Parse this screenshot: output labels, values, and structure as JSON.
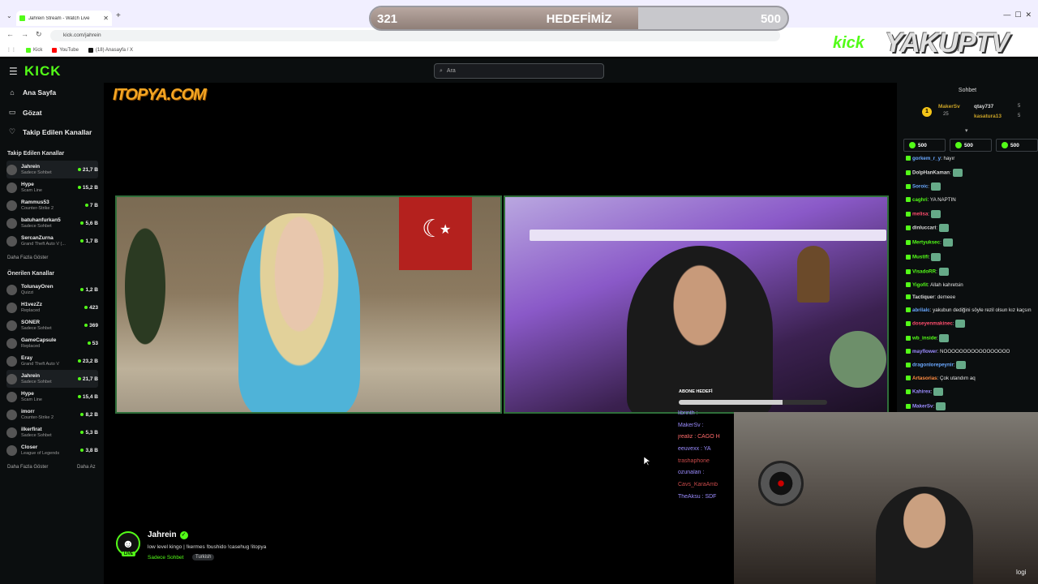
{
  "browser": {
    "tab_title": "Jahrein Stream - Watch Live",
    "url": "kick.com/jahrein",
    "bookmarks": [
      {
        "label": "Kick",
        "color": "#53fc18"
      },
      {
        "label": "YouTube",
        "color": "#ff0000"
      },
      {
        "label": "(18) Anasayfa / X",
        "color": "#111111"
      }
    ]
  },
  "goal": {
    "current": "321",
    "title": "HEDEFİMİZ",
    "target": "500",
    "progress": 0.642
  },
  "overlay_brand": {
    "kick": "kick",
    "name": "YAKUPTV"
  },
  "header": {
    "search_placeholder": "Ara"
  },
  "sidebar": {
    "nav": [
      {
        "label": "Ana Sayfa",
        "icon": "home-icon"
      },
      {
        "label": "Gözat",
        "icon": "browse-icon"
      },
      {
        "label": "Takip Edilen Kanallar",
        "icon": "heart-icon"
      }
    ],
    "followed_header": "Takip Edilen Kanallar",
    "followed": [
      {
        "name": "Jahrein",
        "category": "Sadece Sohbet",
        "viewers": "21,7 B",
        "active": true
      },
      {
        "name": "Hype",
        "category": "Scam Line",
        "viewers": "15,2 B"
      },
      {
        "name": "Rammus53",
        "category": "Counter-Strike 2",
        "viewers": "7 B"
      },
      {
        "name": "batuhanfurkan5",
        "category": "Sadece Sohbet",
        "viewers": "5,6 B"
      },
      {
        "name": "SercanZurna",
        "category": "Grand Theft Auto V (...",
        "viewers": "1,7 B"
      }
    ],
    "followed_more": "Daha Fazla Göster",
    "recommended_header": "Önerilen Kanallar",
    "recommended": [
      {
        "name": "TolunayOren",
        "category": "Quizzi",
        "viewers": "1,2 B"
      },
      {
        "name": "H1vezZz",
        "category": "Replaced",
        "viewers": "423"
      },
      {
        "name": "SONER",
        "category": "Sadece Sohbet",
        "viewers": "369"
      },
      {
        "name": "GameCapsule",
        "category": "Replaced",
        "viewers": "53"
      },
      {
        "name": "Eray",
        "category": "Grand Theft Auto V",
        "viewers": "23,2 B"
      },
      {
        "name": "Jahrein",
        "category": "Sadece Sohbet",
        "viewers": "21,7 B",
        "active": true
      },
      {
        "name": "Hype",
        "category": "Scam Line",
        "viewers": "15,4 B"
      },
      {
        "name": "imorr",
        "category": "Counter-Strike 2",
        "viewers": "8,2 B"
      },
      {
        "name": "ilkerfirat",
        "category": "Sadece Sohbet",
        "viewers": "5,3 B"
      },
      {
        "name": "Closer",
        "category": "League of Legends",
        "viewers": "3,8 B"
      }
    ],
    "recommended_more": "Daha Fazla Göster",
    "recommended_less": "Daha Az"
  },
  "stream": {
    "sponsor": "ITOPYA.COM",
    "sub_goal_label": "ABONE HEDEFİ",
    "sub_goal_progress": 0.7,
    "overlay_chat": [
      {
        "user": "librinth :",
        "color": "#9b8cff"
      },
      {
        "user": "MakerSv :",
        "color": "#9b8cff"
      },
      {
        "user": "jrealiz : CAGO H",
        "color": "#ff6b6b"
      },
      {
        "user": "eeuvexx : YA",
        "color": "#9b8cff"
      },
      {
        "user": "trashaphone",
        "color": "#c84a4a"
      },
      {
        "user": "ozunalan :",
        "color": "#9b8cff"
      },
      {
        "user": "Cavs_KaraAmb",
        "color": "#c84a4a"
      },
      {
        "user": "TheAksu : SDF",
        "color": "#9b8cff"
      }
    ]
  },
  "streamer": {
    "name": "Jahrein",
    "live": "LIVE",
    "title": "low level kingo | !kermes !bushido !casehug !itopya",
    "category": "Sadece Sohbet",
    "language": "Turkish"
  },
  "chat": {
    "title": "Sohbet",
    "pinned": {
      "first": {
        "user": "MakerSv",
        "count": "25"
      },
      "second": {
        "user": "qtay737",
        "count": "5"
      },
      "third": {
        "user": "kasatura13",
        "count": "5"
      }
    },
    "gifts": [
      "500",
      "500",
      "500"
    ],
    "messages": [
      {
        "user": "gorkem_r_y",
        "text": ": hayır",
        "color": "#6aa8ff"
      },
      {
        "user": "DolpHanKaman",
        "text": ":",
        "color": "#dddddd",
        "emote": true
      },
      {
        "user": "Soroic",
        "text": ":",
        "color": "#6aa8ff",
        "emote": true
      },
      {
        "user": "caghri",
        "text": ": YA NAPTIN",
        "color": "#53fc18"
      },
      {
        "user": "melisa",
        "text": ":",
        "color": "#ff4d6d",
        "emote": true
      },
      {
        "user": "dinluccari",
        "text": ":",
        "color": "#dddddd",
        "emote": true
      },
      {
        "user": "Mertyuksec",
        "text": ":",
        "color": "#53fc18",
        "emote": true
      },
      {
        "user": "Mustifi",
        "text": ":",
        "color": "#53fc18",
        "emote": true
      },
      {
        "user": "VisadoRR",
        "text": ":",
        "color": "#53fc18",
        "emote": true
      },
      {
        "user": "Yigofit",
        "text": ": Allah kahretsin",
        "color": "#53fc18"
      },
      {
        "user": "Tactiquer",
        "text": ": demeee",
        "color": "#dddddd"
      },
      {
        "user": "abrilalc",
        "text": ": yakubun dediğini söyle rezil olsun kız kaçsın",
        "color": "#6aa8ff"
      },
      {
        "user": "doseyenmakinec",
        "text": ":",
        "color": "#ff4d6d",
        "emote": true
      },
      {
        "user": "wb_inside",
        "text": ":",
        "color": "#53fc18",
        "emote": true
      },
      {
        "user": "mayflower",
        "text": ": NOOOOOOOOOOOOOOOOO",
        "color": "#9b8cff"
      },
      {
        "user": "dragonlorepeynir",
        "text": ":",
        "color": "#6aa8ff",
        "emote": true
      },
      {
        "user": "Artasorias",
        "text": ": Çok utandım aq",
        "color": "#ff8c42"
      },
      {
        "user": "Kahirex",
        "text": ":",
        "color": "#9b8cff",
        "emote": true
      },
      {
        "user": "MakerSv",
        "text": ":",
        "color": "#9b8cff",
        "emote": true
      }
    ]
  },
  "webcam": {
    "watermark": "logi"
  }
}
